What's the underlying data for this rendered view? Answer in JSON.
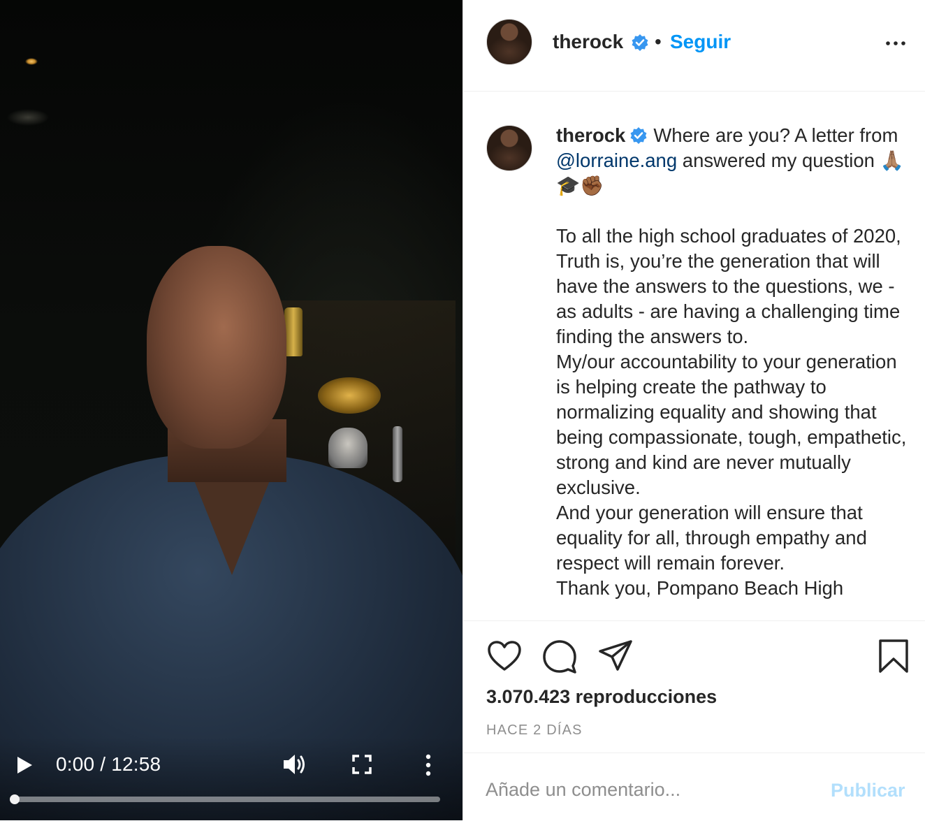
{
  "video": {
    "timecode": "0:00 / 12:58",
    "progress_fraction": 0,
    "icons": [
      "play-icon",
      "volume-icon",
      "fullscreen-icon",
      "more-vertical-icon"
    ]
  },
  "header": {
    "username": "therock",
    "separator": "•",
    "follow_label": "Seguir",
    "icons": [
      "verified-badge-icon",
      "more-horizontal-icon"
    ]
  },
  "caption": {
    "username": "therock",
    "line1_text": "Where are you? A letter from ",
    "mention": "@lorraine.ang",
    "line1_after": " answered my question",
    "emoji": "🙏🏽🎓✊🏾",
    "body": "To all the high school graduates of 2020,\nTruth is, you’re the generation that will have the answers to the questions, we - as adults - are having a challenging time finding the answers to.\nMy/our accountability to your generation is helping create the pathway to normalizing equality and showing that being compassionate, tough, empathetic, strong and kind are never mutually exclusive.\nAnd your generation will ensure that equality for all, through empathy and respect will remain forever.\nThank you, Pompano Beach High"
  },
  "actions": {
    "icons": [
      "heart-icon",
      "comment-icon",
      "share-icon",
      "bookmark-icon"
    ],
    "views": "3.070.423 reproducciones",
    "timestamp": "HACE 2 DÍAS"
  },
  "comment": {
    "placeholder": "Añade un comentario...",
    "value": "",
    "publish_label": "Publicar"
  },
  "colors": {
    "accent": "#0095f6",
    "publish_disabled": "#b2dffc",
    "mention": "#00376b",
    "muted": "#8e8e8e",
    "text": "#262626"
  }
}
